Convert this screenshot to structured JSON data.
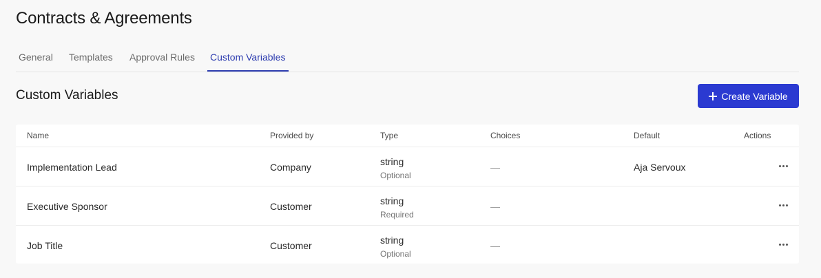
{
  "page": {
    "title": "Contracts & Agreements"
  },
  "tabs": [
    {
      "label": "General",
      "active": false
    },
    {
      "label": "Templates",
      "active": false
    },
    {
      "label": "Approval Rules",
      "active": false
    },
    {
      "label": "Custom Variables",
      "active": true
    }
  ],
  "section": {
    "title": "Custom Variables",
    "create_label": "Create Variable"
  },
  "table": {
    "columns": [
      "Name",
      "Provided by",
      "Type",
      "Choices",
      "Default",
      "Actions"
    ],
    "rows": [
      {
        "name": "Implementation Lead",
        "provided_by": "Company",
        "type": "string",
        "requirement": "Optional",
        "choices": "—",
        "default": "Aja Servoux"
      },
      {
        "name": "Executive Sponsor",
        "provided_by": "Customer",
        "type": "string",
        "requirement": "Required",
        "choices": "—",
        "default": ""
      },
      {
        "name": "Job Title",
        "provided_by": "Customer",
        "type": "string",
        "requirement": "Optional",
        "choices": "—",
        "default": ""
      }
    ]
  },
  "icons": {
    "create": "plus-icon",
    "row_actions": "more-horizontal-icon"
  },
  "colors": {
    "accent": "#2b3ad1",
    "active_tab": "#2e3db0",
    "background": "#f8f8f8"
  }
}
